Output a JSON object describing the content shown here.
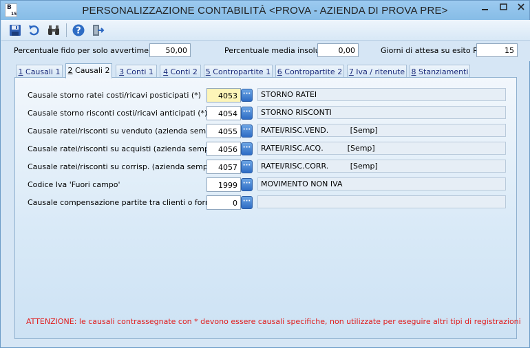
{
  "window": {
    "title": "PERSONALIZZAZIONE CONTABILITÀ <PROVA - AZIENDA DI PROVA PRE>",
    "app_icon_letter": "B",
    "app_icon_sub": "15"
  },
  "toolbar": {
    "icons": [
      "save-icon",
      "undo-icon",
      "binoculars-icon",
      "help-icon",
      "exit-icon"
    ]
  },
  "params": {
    "fido_label": "Percentuale fido per solo avvertimento",
    "fido_value": "50,00",
    "insoluti_label": "Percentuale media insoluti",
    "insoluti_value": "0,00",
    "giorni_label": "Giorni di attesa su esito RB",
    "giorni_value": "15"
  },
  "tabs": [
    {
      "key": "1",
      "label": " Causali 1"
    },
    {
      "key": "2",
      "label": " Causali 2"
    },
    {
      "key": "3",
      "label": " Conti 1"
    },
    {
      "key": "4",
      "label": " Conti 2"
    },
    {
      "key": "5",
      "label": " Contropartite 1"
    },
    {
      "key": "6",
      "label": " Contropartite 2"
    },
    {
      "key": "7",
      "label": " Iva / ritenute"
    },
    {
      "key": "8",
      "label": " Stanziamenti"
    }
  ],
  "rows": [
    {
      "label": "Causale storno ratei costi/ricavi posticipati (*)",
      "code": "4053",
      "desc": "STORNO RATEI"
    },
    {
      "label": "Causale storno risconti costi/ricavi anticipati (*)",
      "code": "4054",
      "desc": "STORNO RISCONTI"
    },
    {
      "label": "Causale ratei/risconti su venduto (azienda sempl.) (*)",
      "code": "4055",
      "desc": "RATEI/RISC.VEND.         [Semp]"
    },
    {
      "label": "Causale ratei/risconti su acquisti (azienda sempl.) (*)",
      "code": "4056",
      "desc": "RATEI/RISC.ACQ.          [Semp]"
    },
    {
      "label": "Causale ratei/risconti su corrisp. (azienda sempl.) (*)",
      "code": "4057",
      "desc": "RATEI/RISC.CORR.         [Semp]"
    },
    {
      "label": "Codice Iva 'Fuori campo'",
      "code": "1999",
      "desc": "MOVIMENTO NON IVA"
    },
    {
      "label": "Causale compensazione partite tra clienti o fornitori",
      "code": "0",
      "desc": ""
    }
  ],
  "lookup_glyph": "···",
  "warning": "ATTENZIONE: le causali contrassegnate con * devono essere causali specifiche, non utilizzate per eseguire altri tipi di registrazioni",
  "colors": {
    "warning": "#e01b1b",
    "focused_field": "#fdf5b8"
  }
}
